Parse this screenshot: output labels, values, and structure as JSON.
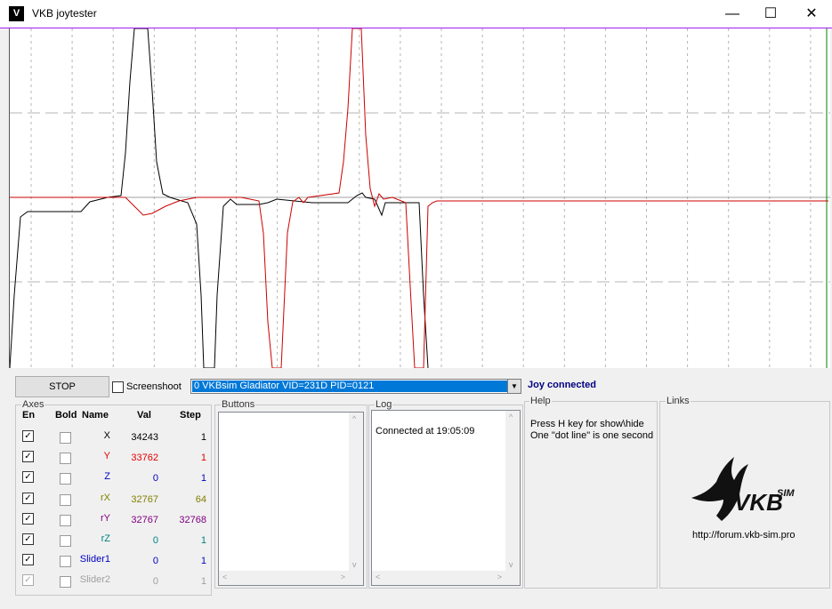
{
  "window": {
    "title": "VKB joytester",
    "icon": "vkb-app-icon"
  },
  "titlebar_buttons": {
    "minimize": "—",
    "maximize": "☐",
    "close": "✕"
  },
  "colors": {
    "trace_black": "#000000",
    "trace_red": "#cc0000",
    "grid": "#b4b4b4",
    "baseline": "#a0a0a0",
    "status": "#000080",
    "selected_device": "#0078d7"
  },
  "toolbar": {
    "stop_label": "STOP",
    "screenshot_label": "Screenshoot",
    "screenshot_checked": false,
    "device_selected": "0 VKBsim Gladiator  VID=231D PID=0121",
    "status": "Joy connected"
  },
  "axes": {
    "title": "Axes",
    "headers": {
      "en": "En",
      "bold": "Bold",
      "name": "Name",
      "val": "Val",
      "step": "Step"
    },
    "rows": [
      {
        "en": true,
        "bold": false,
        "name": "X",
        "val": "34243",
        "step": "1",
        "color": "#000000",
        "disabled": false
      },
      {
        "en": true,
        "bold": false,
        "name": "Y",
        "val": "33762",
        "step": "1",
        "color": "#e00000",
        "disabled": false
      },
      {
        "en": true,
        "bold": false,
        "name": "Z",
        "val": "0",
        "step": "1",
        "color": "#0000c0",
        "disabled": false
      },
      {
        "en": true,
        "bold": false,
        "name": "rX",
        "val": "32767",
        "step": "64",
        "color": "#808000",
        "disabled": false
      },
      {
        "en": true,
        "bold": false,
        "name": "rY",
        "val": "32767",
        "step": "32768",
        "color": "#800080",
        "disabled": false
      },
      {
        "en": true,
        "bold": false,
        "name": "rZ",
        "val": "0",
        "step": "1",
        "color": "#008080",
        "disabled": false
      },
      {
        "en": true,
        "bold": false,
        "name": "Slider1",
        "val": "0",
        "step": "1",
        "color": "#0000c0",
        "disabled": false
      },
      {
        "en": true,
        "bold": false,
        "name": "Slider2",
        "val": "0",
        "step": "1",
        "color": "#a0a0a0",
        "disabled": true
      }
    ]
  },
  "buttons_group": {
    "title": "Buttons"
  },
  "log_group": {
    "title": "Log",
    "text": "Connected at 19:05:09"
  },
  "help_group": {
    "title": "Help",
    "line1": "Press H key for show\\hide",
    "line2": "One \"dot line\" is one second"
  },
  "links_group": {
    "title": "Links",
    "logo_text": "VKB",
    "logo_sup": "SIM",
    "url": "http://forum.vkb-sim.pro"
  }
}
